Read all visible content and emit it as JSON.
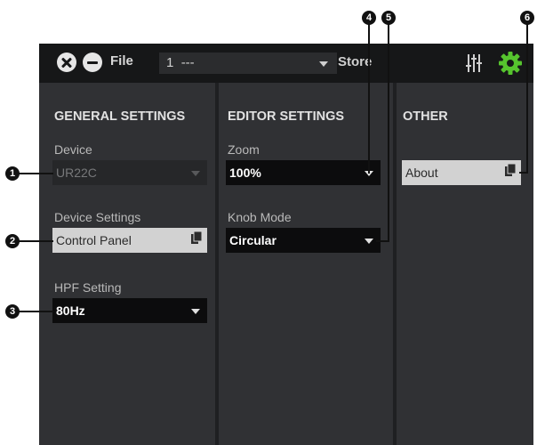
{
  "titlebar": {
    "file_label": "File",
    "scene_number": "1",
    "scene_name": "---",
    "store_label": "Store"
  },
  "general": {
    "title": "GENERAL SETTINGS",
    "device_label": "Device",
    "device_value": "UR22C",
    "device_settings_label": "Device Settings",
    "control_panel_label": "Control Panel",
    "hpf_label": "HPF Setting",
    "hpf_value": "80Hz"
  },
  "editor": {
    "title": "EDITOR SETTINGS",
    "zoom_label": "Zoom",
    "zoom_value": "100%",
    "knob_label": "Knob Mode",
    "knob_value": "Circular"
  },
  "other": {
    "title": "OTHER",
    "about_label": "About"
  },
  "callouts": [
    "1",
    "2",
    "3",
    "4",
    "5",
    "6"
  ],
  "colors": {
    "accent_green": "#56c42e",
    "background": "#303134",
    "titlebar": "#161718"
  },
  "icons": {
    "close": "close-icon",
    "minimize": "minimize-icon",
    "mixer": "mixer-icon",
    "settings": "gear-icon",
    "copy": "copy-icon"
  }
}
